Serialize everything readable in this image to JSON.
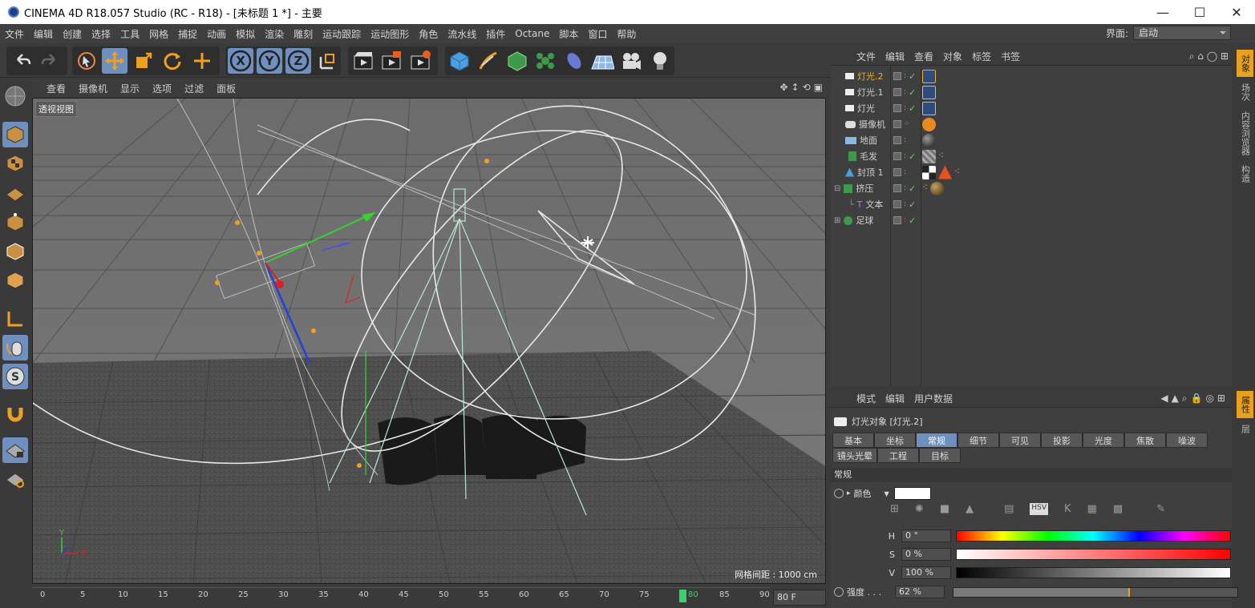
{
  "window": {
    "title": "CINEMA 4D R18.057 Studio (RC - R18) - [未标题 1 *] - 主要",
    "minimize": "—",
    "maximize": "☐",
    "close": "✕"
  },
  "menu": [
    "文件",
    "编辑",
    "创建",
    "选择",
    "工具",
    "网格",
    "捕捉",
    "动画",
    "模拟",
    "渲染",
    "雕刻",
    "运动跟踪",
    "运动图形",
    "角色",
    "流水线",
    "插件",
    "Octane",
    "脚本",
    "窗口",
    "帮助"
  ],
  "layout": {
    "label": "界面:",
    "value": "启动"
  },
  "viewport": {
    "menu": [
      "查看",
      "摄像机",
      "显示",
      "选项",
      "过滤",
      "面板"
    ],
    "label": "透视视图",
    "grid_label": "网格间距 : 1000 cm",
    "axis_y": "Y",
    "axis_x": "X"
  },
  "timeline": {
    "ticks": [
      "0",
      "5",
      "10",
      "15",
      "20",
      "25",
      "30",
      "35",
      "40",
      "45",
      "50",
      "55",
      "60",
      "65",
      "70",
      "75",
      "80",
      "85",
      "90"
    ],
    "current": "80",
    "frame_field": "80 F"
  },
  "object_manager": {
    "menu": [
      "文件",
      "编辑",
      "查看",
      "对象",
      "标签",
      "书签"
    ],
    "objects": [
      {
        "name": "灯光.2",
        "selected": true
      },
      {
        "name": "灯光.1"
      },
      {
        "name": "灯光"
      },
      {
        "name": "摄像机"
      },
      {
        "name": "地面"
      },
      {
        "name": "毛发"
      },
      {
        "name": "封顶 1"
      },
      {
        "name": "挤压"
      },
      {
        "name": "文本"
      },
      {
        "name": "足球"
      }
    ]
  },
  "side_tabs": [
    "对象",
    "场次",
    "内容浏览器",
    "构造"
  ],
  "side_tabs2": [
    "属性",
    "层"
  ],
  "attributes": {
    "menu": [
      "模式",
      "编辑",
      "用户数据"
    ],
    "object_title": "灯光对象 [灯光.2]",
    "tabs_row1": [
      "基本",
      "坐标",
      "常规",
      "细节",
      "可见",
      "投影",
      "光度",
      "焦散",
      "噪波"
    ],
    "tabs_row2": [
      "镜头光晕",
      "工程",
      "目标"
    ],
    "active_tab": "常规",
    "section": "常规",
    "color_label": "颜色",
    "h_label": "H",
    "h_value": "0 °",
    "s_label": "S",
    "s_value": "0 %",
    "v_label": "V",
    "v_value": "100 %",
    "intensity_label": "强度 . . .",
    "intensity_value": "62 %",
    "intensity_fraction": 0.62
  }
}
